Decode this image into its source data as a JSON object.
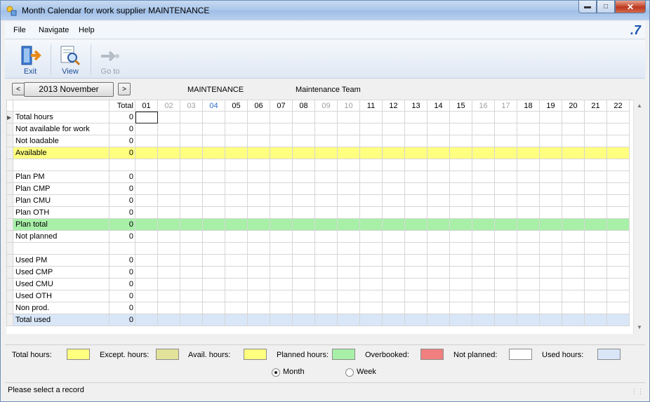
{
  "window": {
    "title": "Month Calendar for work supplier MAINTENANCE"
  },
  "menu": {
    "file": "File",
    "navigate": "Navigate",
    "help": "Help",
    "brand": ".7"
  },
  "toolbar": {
    "exit": "Exit",
    "view": "View",
    "goto": "Go to"
  },
  "nav": {
    "prev": "<",
    "month": "2013 November",
    "next": ">",
    "supplier": "MAINTENANCE",
    "team": "Maintenance Team"
  },
  "grid": {
    "total_header": "Total",
    "days": [
      "01",
      "02",
      "03",
      "04",
      "05",
      "06",
      "07",
      "08",
      "09",
      "10",
      "11",
      "12",
      "13",
      "14",
      "15",
      "16",
      "17",
      "18",
      "19",
      "20",
      "21",
      "22"
    ],
    "rows": [
      {
        "label": "Total hours",
        "total": "0"
      },
      {
        "label": "Not available for work",
        "total": "0"
      },
      {
        "label": "Not loadable",
        "total": "0"
      },
      {
        "label": "Available",
        "total": "0"
      },
      {
        "label": "",
        "total": ""
      },
      {
        "label": "Plan PM",
        "total": "0"
      },
      {
        "label": "Plan CMP",
        "total": "0"
      },
      {
        "label": "Plan CMU",
        "total": "0"
      },
      {
        "label": "Plan OTH",
        "total": "0"
      },
      {
        "label": "Plan total",
        "total": "0"
      },
      {
        "label": "Not planned",
        "total": "0"
      },
      {
        "label": "",
        "total": ""
      },
      {
        "label": "Used PM",
        "total": "0"
      },
      {
        "label": "Used CMP",
        "total": "0"
      },
      {
        "label": "Used CMU",
        "total": "0"
      },
      {
        "label": "Used OTH",
        "total": "0"
      },
      {
        "label": "Non prod.",
        "total": "0"
      },
      {
        "label": "Total used",
        "total": "0"
      }
    ]
  },
  "legend": {
    "total_hours": "Total hours:",
    "except_hours": "Except. hours:",
    "avail_hours": "Avail. hours:",
    "planned_hours": "Planned hours:",
    "overbooked": "Overbooked:",
    "not_planned": "Not planned:",
    "used_hours": "Used hours:",
    "colors": {
      "total_hours": "#ffff80",
      "except_hours": "#e2e29a",
      "avail_hours": "#ffff80",
      "planned_hours": "#a8f0a8",
      "overbooked": "#f08080",
      "not_planned": "#ffffff",
      "used_hours": "#d8e6f8"
    }
  },
  "view_mode": {
    "month": "Month",
    "week": "Week",
    "selected": "Month"
  },
  "status": {
    "text": "Please select a record"
  }
}
